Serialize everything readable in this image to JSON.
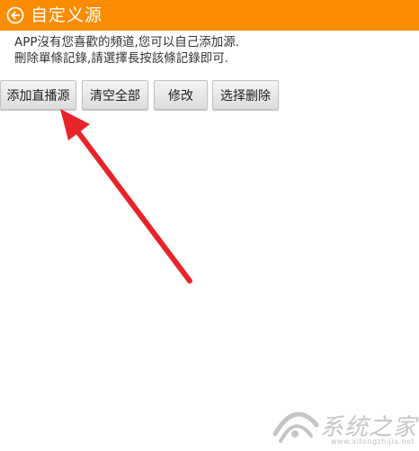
{
  "header": {
    "title": "自定义源",
    "back_icon": "back-arrow-circle-icon",
    "background_color": "#fb8c00"
  },
  "hint": {
    "line1": "APP沒有您喜歡的頻道,您可以自己添加源.",
    "line2": "刪除單條記錄,請選擇長按該條記錄即可."
  },
  "buttons": {
    "add_live_source": "添加直播源",
    "clear_all": "清空全部",
    "modify": "修改",
    "select_delete": "选择删除"
  },
  "annotation": {
    "color": "#e8242a",
    "icon": "red-arrow-icon"
  },
  "watermark": {
    "text": "系统之家",
    "sub": "www.xitongzhijia.net"
  }
}
